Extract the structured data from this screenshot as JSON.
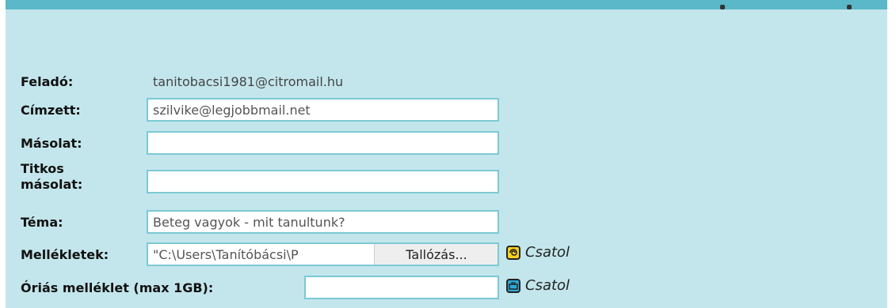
{
  "form": {
    "sender": {
      "label": "Feladó:",
      "value": "tanitobacsi1981@citromail.hu"
    },
    "to": {
      "label": "Címzett:",
      "value": "szilvike@legjobbmail.net"
    },
    "cc": {
      "label": "Másolat:",
      "value": ""
    },
    "bcc": {
      "label_line1": "Titkos",
      "label_line2": "másolat:",
      "value": ""
    },
    "subject": {
      "label": "Téma:",
      "value": "Beteg vagyok - mit tanultunk?"
    },
    "attachments": {
      "label": "Mellékletek:",
      "file_value": "\"C:\\Users\\Tanítóbácsi\\P",
      "browse_label": "Tallózás...",
      "attach_label": "Csatol",
      "icon": "paperclip-icon",
      "icon_color": "#f5d21f"
    },
    "giant_attachment": {
      "label": "Óriás melléklet (max 1GB):",
      "value": "",
      "attach_label": "Csatol",
      "icon": "briefcase-icon",
      "icon_color": "#2aa8d8"
    }
  }
}
